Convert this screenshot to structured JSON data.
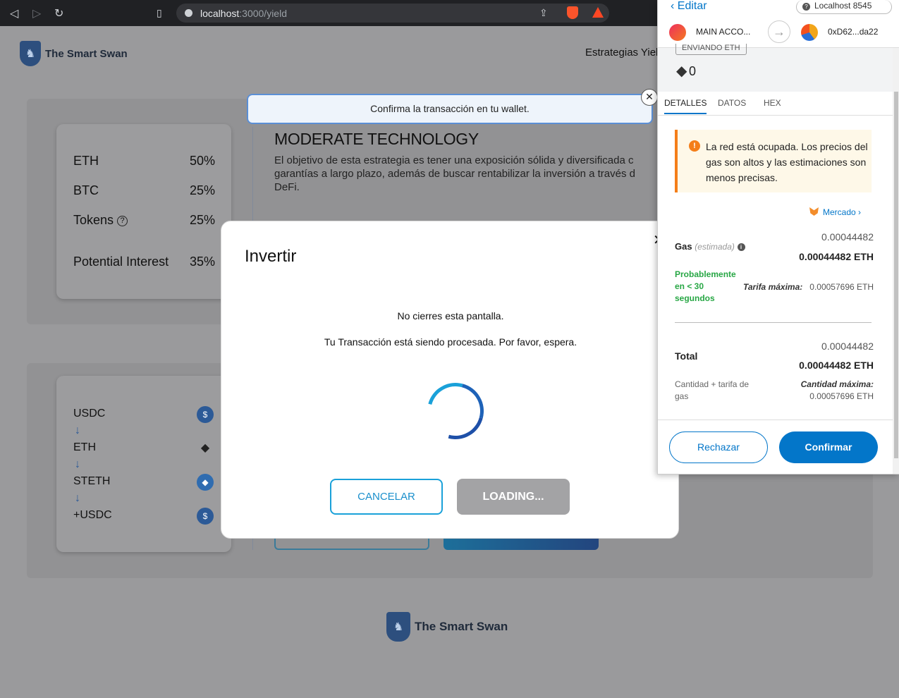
{
  "browser": {
    "url_host": "localhost",
    "url_path": ":3000/yield"
  },
  "site": {
    "brand": "The Smart Swan",
    "nav_item": "Estrategias Yiel"
  },
  "allocation": [
    {
      "name": "ETH",
      "value": "50%"
    },
    {
      "name": "BTC",
      "value": "25%"
    },
    {
      "name": "Tokens",
      "value": "25%"
    },
    {
      "name": "Potential Interest",
      "value": "35%"
    }
  ],
  "route": [
    "USDC",
    "ETH",
    "STETH",
    "+USDC"
  ],
  "route_arrow": "↓",
  "strategy": {
    "title": "MODERATE TECHNOLOGY",
    "description": "El objetivo de esta estrategia es tener una exposición sólida y diversificada c\ngarantías a largo plazo, además de buscar rentabilizar la inversión a través d\nDeFi."
  },
  "toast": {
    "message": "Confirma la transacción en tu wallet."
  },
  "modal": {
    "title": "Invertir",
    "message1": "No cierres esta pantalla.",
    "message2": "Tu Transacción está siendo procesada. Por favor, espera.",
    "cancel_label": "CANCELAR",
    "loading_label": "LOADING..."
  },
  "metamask": {
    "edit_label": "Editar",
    "network": "Localhost 8545",
    "from_account": "MAIN ACCO...",
    "to_account": "0xD62...da22",
    "sending_label": "ENVIANDO ETH",
    "amount": "0",
    "tabs": [
      "DETALLES",
      "DATOS",
      "HEX"
    ],
    "warning": "La red está ocupada. Los precios del gas son altos y las estimaciones son menos precisas.",
    "market_label": "Mercado",
    "gas_label": "Gas",
    "gas_estimated": "(estimada)",
    "gas_small": "0.00044482",
    "gas_big": "0.00044482 ETH",
    "likely": "Probablemente en < 30 segundos",
    "max_fee_label": "Tarifa máxima:",
    "max_fee_value": "0.00057696 ETH",
    "total_label": "Total",
    "total_small": "0.00044482",
    "total_big": "0.00044482 ETH",
    "amount_gas_label": "Cantidad + tarifa de gas",
    "max_amount_label": "Cantidad máxima:",
    "max_amount_value": "0.00057696 ETH",
    "reject_label": "Rechazar",
    "confirm_label": "Confirmar"
  }
}
